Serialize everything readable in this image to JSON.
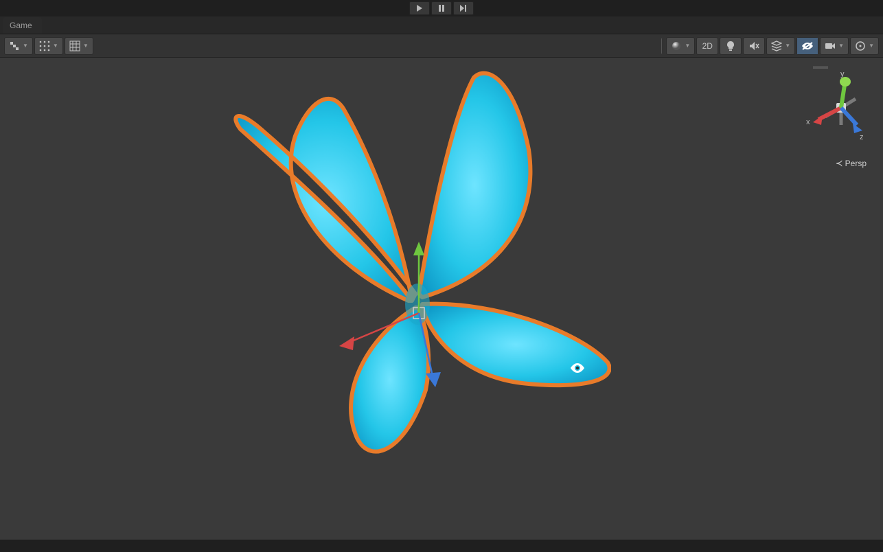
{
  "playback": {
    "play_icon": "play",
    "pause_icon": "pause",
    "step_icon": "step-forward"
  },
  "tabs": {
    "game": "Game"
  },
  "toolbar": {
    "label_2d": "2D",
    "shading_icon": "shaded-sphere",
    "light_icon": "lightbulb",
    "audio_icon": "audio-mute",
    "fx_icon": "layers",
    "visibility_icon": "eye-off",
    "camera_icon": "camera",
    "gizmos_icon": "gizmos"
  },
  "gizmo": {
    "x_label": "x",
    "y_label": "y",
    "z_label": "z",
    "projection": "Persp"
  },
  "axis_colors": {
    "x": "#d64545",
    "y": "#6fc73f",
    "z": "#3a78d8"
  },
  "selection": {
    "outline": "#e87b2a",
    "fill_primary": "#24c6e8",
    "fill_secondary": "#0aa6d6",
    "fill_highlight": "#6ee4ff"
  }
}
